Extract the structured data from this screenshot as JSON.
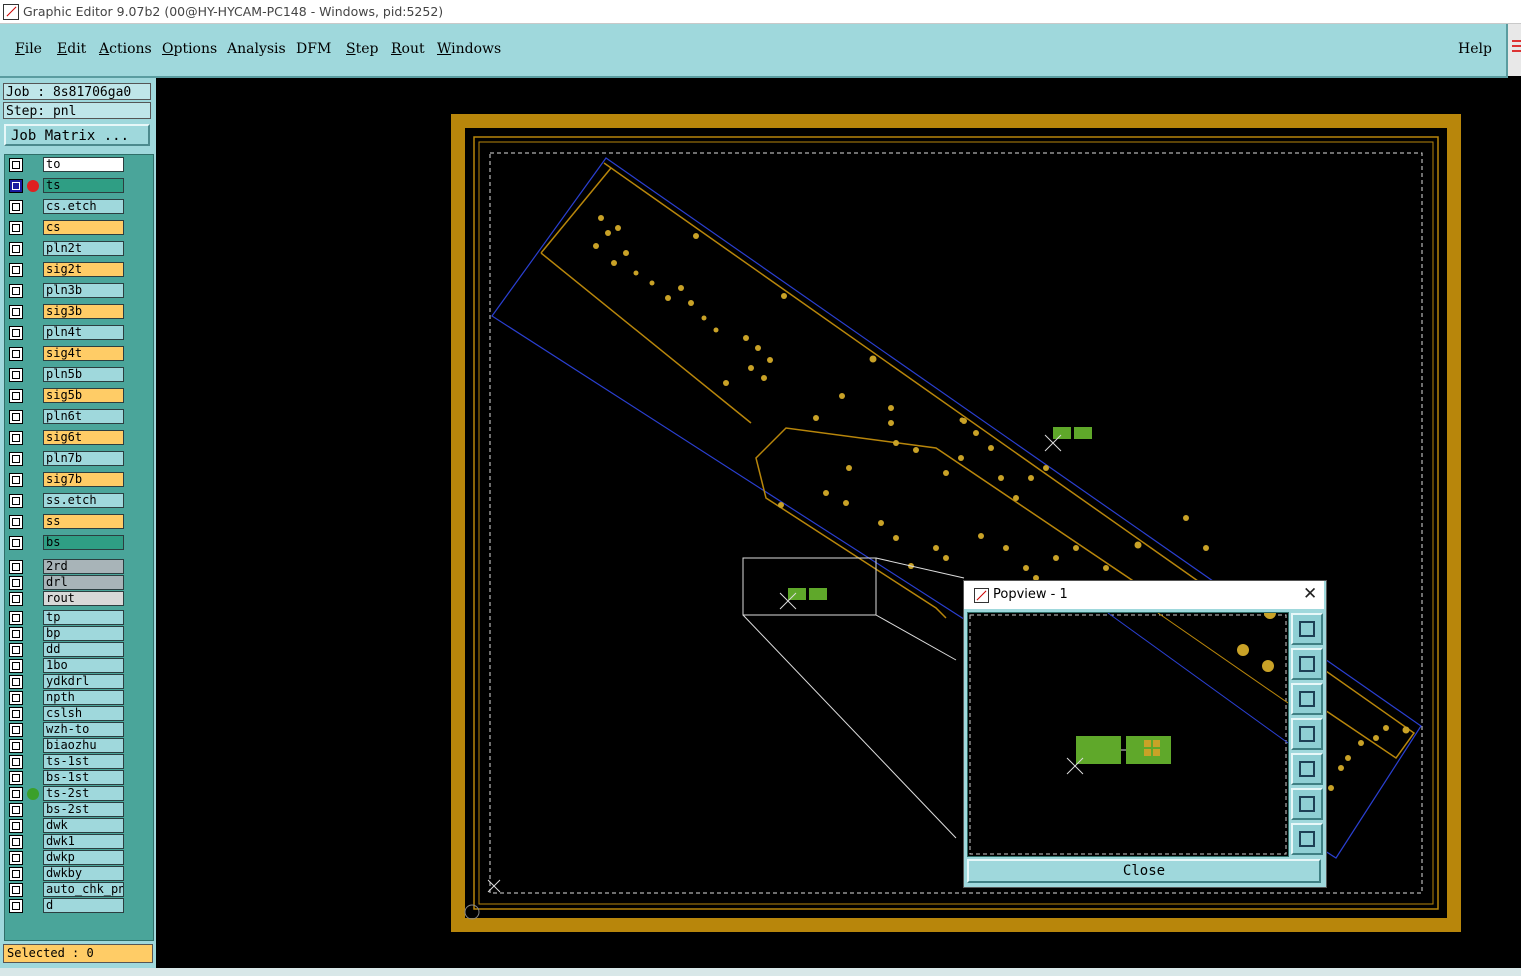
{
  "window": {
    "title": "Graphic Editor 9.07b2 (00@HY-HYCAM-PC148 - Windows, pid:5252)"
  },
  "menu": {
    "items": [
      {
        "mnemonic": "F",
        "rest": "ile"
      },
      {
        "mnemonic": "E",
        "rest": "dit"
      },
      {
        "mnemonic": "A",
        "rest": "ctions"
      },
      {
        "mnemonic": "O",
        "rest": "ptions"
      },
      {
        "mnemonic": "",
        "rest": "Analysis"
      },
      {
        "mnemonic": "",
        "rest": "DFM"
      },
      {
        "mnemonic": "S",
        "rest": "tep"
      },
      {
        "mnemonic": "R",
        "rest": "out"
      },
      {
        "mnemonic": "W",
        "rest": "indows"
      }
    ],
    "help": "Help"
  },
  "job": {
    "job_label": "Job : 8s81706ga0",
    "step_label": "Step: pnl",
    "matrix_button": "Job Matrix ..."
  },
  "layers": [
    {
      "name": "to",
      "color": "#ffffff",
      "state": "normal"
    },
    {
      "name": "ts",
      "color": "#2f9e84",
      "state": "active",
      "dot": "#e02020"
    },
    {
      "name": "cs.etch",
      "color": "#9fd8dc",
      "state": "normal"
    },
    {
      "name": "cs",
      "color": "#ffcc66",
      "state": "normal"
    },
    {
      "name": "pln2t",
      "color": "#9fd8dc",
      "state": "normal"
    },
    {
      "name": "sig2t",
      "color": "#ffcc66",
      "state": "normal"
    },
    {
      "name": "pln3b",
      "color": "#9fd8dc",
      "state": "normal"
    },
    {
      "name": "sig3b",
      "color": "#ffcc66",
      "state": "normal"
    },
    {
      "name": "pln4t",
      "color": "#9fd8dc",
      "state": "normal"
    },
    {
      "name": "sig4t",
      "color": "#ffcc66",
      "state": "normal"
    },
    {
      "name": "pln5b",
      "color": "#9fd8dc",
      "state": "normal"
    },
    {
      "name": "sig5b",
      "color": "#ffcc66",
      "state": "normal"
    },
    {
      "name": "pln6t",
      "color": "#9fd8dc",
      "state": "normal"
    },
    {
      "name": "sig6t",
      "color": "#ffcc66",
      "state": "normal"
    },
    {
      "name": "pln7b",
      "color": "#9fd8dc",
      "state": "normal"
    },
    {
      "name": "sig7b",
      "color": "#ffcc66",
      "state": "normal"
    },
    {
      "name": "ss.etch",
      "color": "#9fd8dc",
      "state": "normal"
    },
    {
      "name": "ss",
      "color": "#ffcc66",
      "state": "normal"
    },
    {
      "name": "bs",
      "color": "#2f9e84",
      "state": "normal"
    },
    {
      "name": "2rd",
      "color": "#a8b4b8",
      "state": "normal"
    },
    {
      "name": "drl",
      "color": "#a8b4b8",
      "state": "normal"
    },
    {
      "name": "rout",
      "color": "#d8d8d8",
      "state": "normal"
    },
    {
      "name": "tp",
      "color": "#9fd8dc",
      "state": "normal"
    },
    {
      "name": "bp",
      "color": "#9fd8dc",
      "state": "normal"
    },
    {
      "name": "dd",
      "color": "#9fd8dc",
      "state": "normal"
    },
    {
      "name": "1bo",
      "color": "#9fd8dc",
      "state": "normal"
    },
    {
      "name": "ydkdrl",
      "color": "#9fd8dc",
      "state": "normal"
    },
    {
      "name": "npth",
      "color": "#9fd8dc",
      "state": "normal"
    },
    {
      "name": "cslsh",
      "color": "#9fd8dc",
      "state": "normal"
    },
    {
      "name": "wzh-to",
      "color": "#9fd8dc",
      "state": "normal"
    },
    {
      "name": "biaozhu",
      "color": "#9fd8dc",
      "state": "normal"
    },
    {
      "name": "ts-1st",
      "color": "#9fd8dc",
      "state": "normal"
    },
    {
      "name": "bs-1st",
      "color": "#9fd8dc",
      "state": "normal"
    },
    {
      "name": "ts-2st",
      "color": "#9fd8dc",
      "state": "normal",
      "dot": "#3ba02a"
    },
    {
      "name": "bs-2st",
      "color": "#9fd8dc",
      "state": "normal"
    },
    {
      "name": "dwk",
      "color": "#9fd8dc",
      "state": "normal"
    },
    {
      "name": "dwk1",
      "color": "#9fd8dc",
      "state": "normal"
    },
    {
      "name": "dwkp",
      "color": "#9fd8dc",
      "state": "normal"
    },
    {
      "name": "dwkby",
      "color": "#9fd8dc",
      "state": "normal"
    },
    {
      "name": "auto_chk_pnl",
      "color": "#9fd8dc",
      "state": "normal"
    },
    {
      "name": "d",
      "color": "#9fd8dc",
      "state": "normal"
    }
  ],
  "status": {
    "selected": "Selected : 0"
  },
  "popview": {
    "title": "Popview - 1",
    "close_label": "Close",
    "tools": [
      "zoom-fit-icon",
      "pan-up-icon",
      "pan-down-icon",
      "pan-left-icon",
      "pan-right-icon",
      "zoom-in-icon",
      "zoom-out-icon"
    ]
  },
  "colors": {
    "board_frame": "#b8860b",
    "pad": "#c9a227",
    "outline": "#2a3fd0",
    "feature_green": "#5fa82a"
  }
}
